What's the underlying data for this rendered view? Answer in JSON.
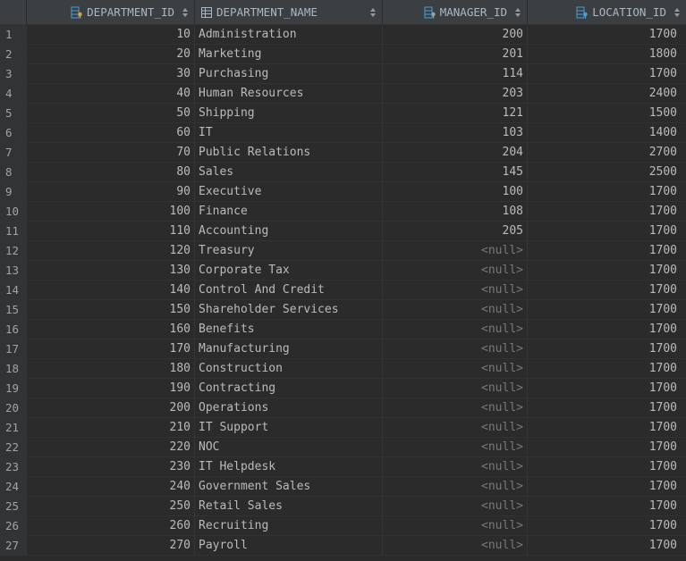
{
  "columns": {
    "department_id": "DEPARTMENT_ID",
    "department_name": "DEPARTMENT_NAME",
    "manager_id": "MANAGER_ID",
    "location_id": "LOCATION_ID"
  },
  "icons": {
    "pk": "primary-key-column-icon",
    "col": "column-icon",
    "fk": "foreign-key-column-icon",
    "sort": "sort-arrows-icon"
  },
  "colors": {
    "background": "#2b2b2b",
    "header": "#3c3f41",
    "row_number_gutter": "#313335",
    "text": "#bbbbbb",
    "null_text": "#787878",
    "key_icon": "#d9a343",
    "column_icon": "#4a9fd8"
  },
  "rows": [
    {
      "n": "1",
      "id": "10",
      "name": "Administration",
      "mgr": "200",
      "loc": "1700"
    },
    {
      "n": "2",
      "id": "20",
      "name": "Marketing",
      "mgr": "201",
      "loc": "1800"
    },
    {
      "n": "3",
      "id": "30",
      "name": "Purchasing",
      "mgr": "114",
      "loc": "1700"
    },
    {
      "n": "4",
      "id": "40",
      "name": "Human Resources",
      "mgr": "203",
      "loc": "2400"
    },
    {
      "n": "5",
      "id": "50",
      "name": "Shipping",
      "mgr": "121",
      "loc": "1500"
    },
    {
      "n": "6",
      "id": "60",
      "name": "IT",
      "mgr": "103",
      "loc": "1400"
    },
    {
      "n": "7",
      "id": "70",
      "name": "Public Relations",
      "mgr": "204",
      "loc": "2700"
    },
    {
      "n": "8",
      "id": "80",
      "name": "Sales",
      "mgr": "145",
      "loc": "2500"
    },
    {
      "n": "9",
      "id": "90",
      "name": "Executive",
      "mgr": "100",
      "loc": "1700"
    },
    {
      "n": "10",
      "id": "100",
      "name": "Finance",
      "mgr": "108",
      "loc": "1700"
    },
    {
      "n": "11",
      "id": "110",
      "name": "Accounting",
      "mgr": "205",
      "loc": "1700"
    },
    {
      "n": "12",
      "id": "120",
      "name": "Treasury",
      "mgr": "<null>",
      "loc": "1700"
    },
    {
      "n": "13",
      "id": "130",
      "name": "Corporate Tax",
      "mgr": "<null>",
      "loc": "1700"
    },
    {
      "n": "14",
      "id": "140",
      "name": "Control And Credit",
      "mgr": "<null>",
      "loc": "1700"
    },
    {
      "n": "15",
      "id": "150",
      "name": "Shareholder Services",
      "mgr": "<null>",
      "loc": "1700"
    },
    {
      "n": "16",
      "id": "160",
      "name": "Benefits",
      "mgr": "<null>",
      "loc": "1700"
    },
    {
      "n": "17",
      "id": "170",
      "name": "Manufacturing",
      "mgr": "<null>",
      "loc": "1700"
    },
    {
      "n": "18",
      "id": "180",
      "name": "Construction",
      "mgr": "<null>",
      "loc": "1700"
    },
    {
      "n": "19",
      "id": "190",
      "name": "Contracting",
      "mgr": "<null>",
      "loc": "1700"
    },
    {
      "n": "20",
      "id": "200",
      "name": "Operations",
      "mgr": "<null>",
      "loc": "1700"
    },
    {
      "n": "21",
      "id": "210",
      "name": "IT Support",
      "mgr": "<null>",
      "loc": "1700"
    },
    {
      "n": "22",
      "id": "220",
      "name": "NOC",
      "mgr": "<null>",
      "loc": "1700"
    },
    {
      "n": "23",
      "id": "230",
      "name": "IT Helpdesk",
      "mgr": "<null>",
      "loc": "1700"
    },
    {
      "n": "24",
      "id": "240",
      "name": "Government Sales",
      "mgr": "<null>",
      "loc": "1700"
    },
    {
      "n": "25",
      "id": "250",
      "name": "Retail Sales",
      "mgr": "<null>",
      "loc": "1700"
    },
    {
      "n": "26",
      "id": "260",
      "name": "Recruiting",
      "mgr": "<null>",
      "loc": "1700"
    },
    {
      "n": "27",
      "id": "270",
      "name": "Payroll",
      "mgr": "<null>",
      "loc": "1700"
    }
  ]
}
